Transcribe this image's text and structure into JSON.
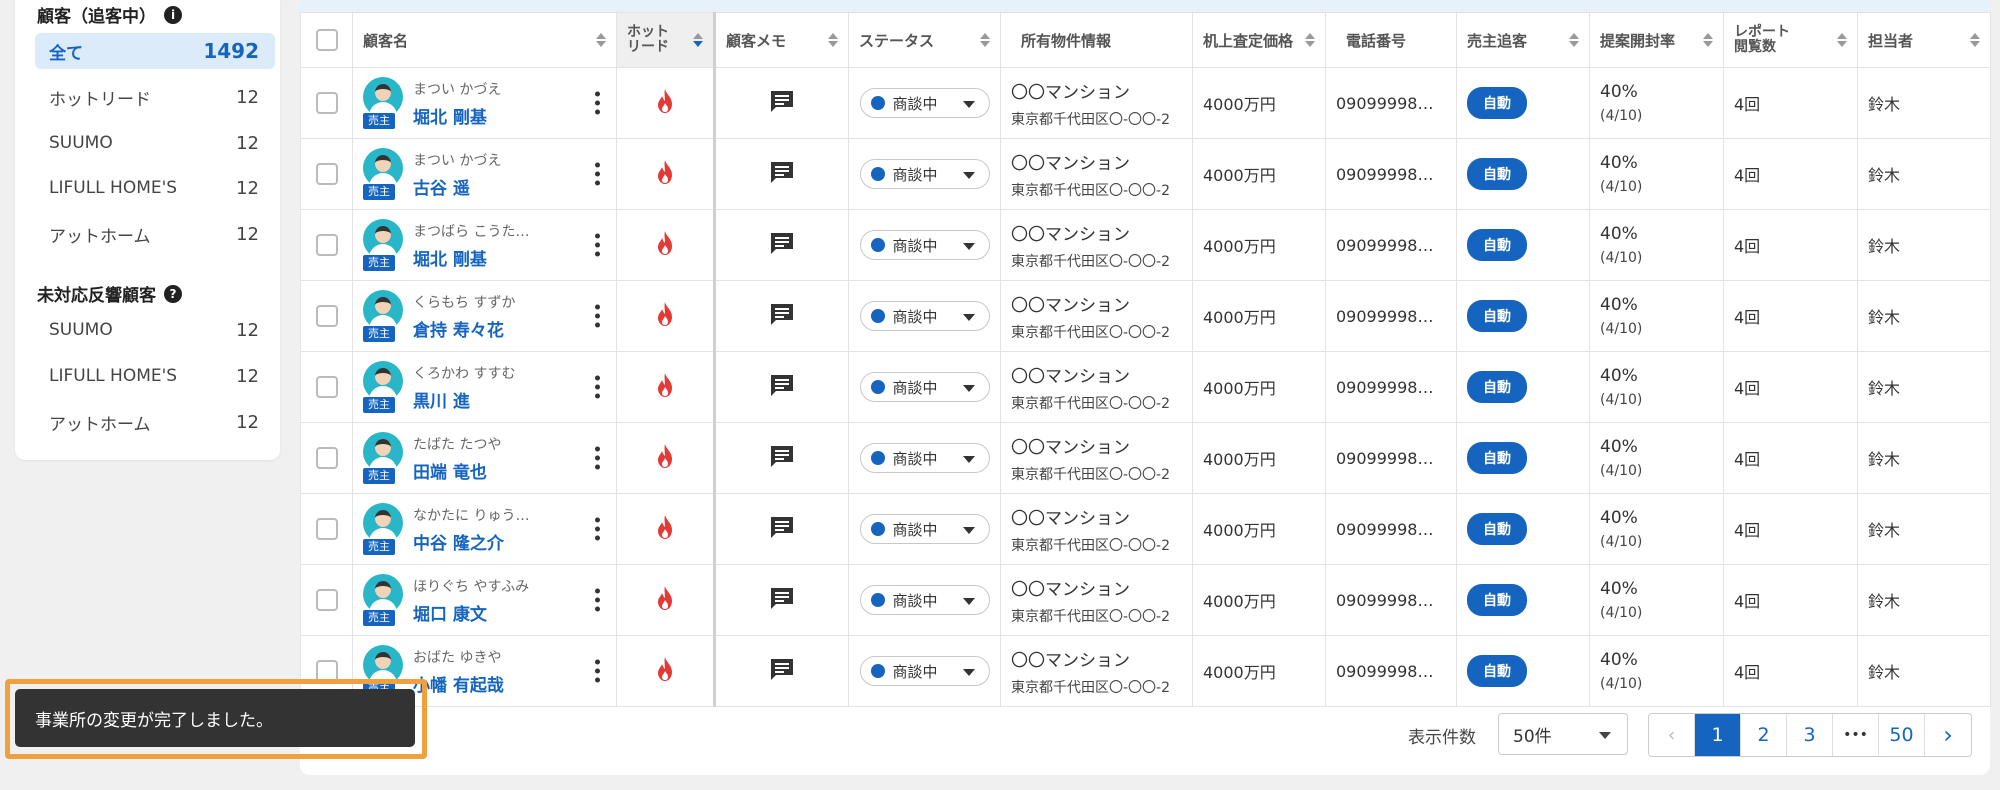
{
  "sidebar": {
    "section1_title": "顧客（追客中）",
    "section1_items": [
      {
        "label": "全て",
        "count": "1492"
      },
      {
        "label": "ホットリード",
        "count": "12"
      },
      {
        "label": "SUUMO",
        "count": "12"
      },
      {
        "label": "LIFULL HOME'S",
        "count": "12"
      },
      {
        "label": "アットホーム",
        "count": "12"
      }
    ],
    "section2_title": "未対応反響顧客",
    "section2_items": [
      {
        "label": "SUUMO",
        "count": "12"
      },
      {
        "label": "LIFULL HOME'S",
        "count": "12"
      },
      {
        "label": "アットホーム",
        "count": "12"
      }
    ]
  },
  "table": {
    "headers": {
      "name": "顧客名",
      "hot_line1": "ホット",
      "hot_line2": "リード",
      "memo": "顧客メモ",
      "status": "ステータス",
      "property": "所有物件情報",
      "price": "机上査定価格",
      "phone": "電話番号",
      "seller": "売主追客",
      "open_rate": "提案開封率",
      "report_line1": "レポート",
      "report_line2": "閲覧数",
      "staff": "担当者"
    },
    "rows": [
      {
        "kana": "まつい かづえ",
        "name": "堀北 剛基",
        "badge": "売主",
        "status": "商談中",
        "prop_name": "〇〇マンション",
        "prop_addr": "東京都千代田区〇-〇〇-2",
        "price": "4000万円",
        "phone": "09099998…",
        "seller": "自動",
        "rate": "40%",
        "rate_sub": "(4/10)",
        "views": "4回",
        "staff": "鈴木"
      },
      {
        "kana": "まつい かづえ",
        "name": "古谷 遥",
        "badge": "売主",
        "status": "商談中",
        "prop_name": "〇〇マンション",
        "prop_addr": "東京都千代田区〇-〇〇-2",
        "price": "4000万円",
        "phone": "09099998…",
        "seller": "自動",
        "rate": "40%",
        "rate_sub": "(4/10)",
        "views": "4回",
        "staff": "鈴木"
      },
      {
        "kana": "まつばら こうた…",
        "name": "堀北 剛基",
        "badge": "売主",
        "status": "商談中",
        "prop_name": "〇〇マンション",
        "prop_addr": "東京都千代田区〇-〇〇-2",
        "price": "4000万円",
        "phone": "09099998…",
        "seller": "自動",
        "rate": "40%",
        "rate_sub": "(4/10)",
        "views": "4回",
        "staff": "鈴木"
      },
      {
        "kana": "くらもち すずか",
        "name": "倉持 寿々花",
        "badge": "売主",
        "status": "商談中",
        "prop_name": "〇〇マンション",
        "prop_addr": "東京都千代田区〇-〇〇-2",
        "price": "4000万円",
        "phone": "09099998…",
        "seller": "自動",
        "rate": "40%",
        "rate_sub": "(4/10)",
        "views": "4回",
        "staff": "鈴木"
      },
      {
        "kana": "くろかわ すすむ",
        "name": "黒川 進",
        "badge": "売主",
        "status": "商談中",
        "prop_name": "〇〇マンション",
        "prop_addr": "東京都千代田区〇-〇〇-2",
        "price": "4000万円",
        "phone": "09099998…",
        "seller": "自動",
        "rate": "40%",
        "rate_sub": "(4/10)",
        "views": "4回",
        "staff": "鈴木"
      },
      {
        "kana": "たばた たつや",
        "name": "田端 竜也",
        "badge": "売主",
        "status": "商談中",
        "prop_name": "〇〇マンション",
        "prop_addr": "東京都千代田区〇-〇〇-2",
        "price": "4000万円",
        "phone": "09099998…",
        "seller": "自動",
        "rate": "40%",
        "rate_sub": "(4/10)",
        "views": "4回",
        "staff": "鈴木"
      },
      {
        "kana": "なかたに りゅう…",
        "name": "中谷 隆之介",
        "badge": "売主",
        "status": "商談中",
        "prop_name": "〇〇マンション",
        "prop_addr": "東京都千代田区〇-〇〇-2",
        "price": "4000万円",
        "phone": "09099998…",
        "seller": "自動",
        "rate": "40%",
        "rate_sub": "(4/10)",
        "views": "4回",
        "staff": "鈴木"
      },
      {
        "kana": "ほりぐち やすふみ",
        "name": "堀口 康文",
        "badge": "売主",
        "status": "商談中",
        "prop_name": "〇〇マンション",
        "prop_addr": "東京都千代田区〇-〇〇-2",
        "price": "4000万円",
        "phone": "09099998…",
        "seller": "自動",
        "rate": "40%",
        "rate_sub": "(4/10)",
        "views": "4回",
        "staff": "鈴木"
      },
      {
        "kana": "おばた ゆきや",
        "name": "小幡 有起哉",
        "badge": "売主",
        "status": "商談中",
        "prop_name": "〇〇マンション",
        "prop_addr": "東京都千代田区〇-〇〇-2",
        "price": "4000万円",
        "phone": "09099998…",
        "seller": "自動",
        "rate": "40%",
        "rate_sub": "(4/10)",
        "views": "4回",
        "staff": "鈴木"
      }
    ]
  },
  "footer": {
    "per_page_label": "表示件数",
    "per_page_value": "50件",
    "pages": [
      "1",
      "2",
      "3",
      "•••",
      "50"
    ],
    "prev": "‹",
    "next": "›"
  },
  "toast": {
    "message": "事業所の変更が完了しました。"
  },
  "colors": {
    "accent": "#1565c0",
    "flame": "#e53935",
    "toast_border": "#f2a03d"
  }
}
